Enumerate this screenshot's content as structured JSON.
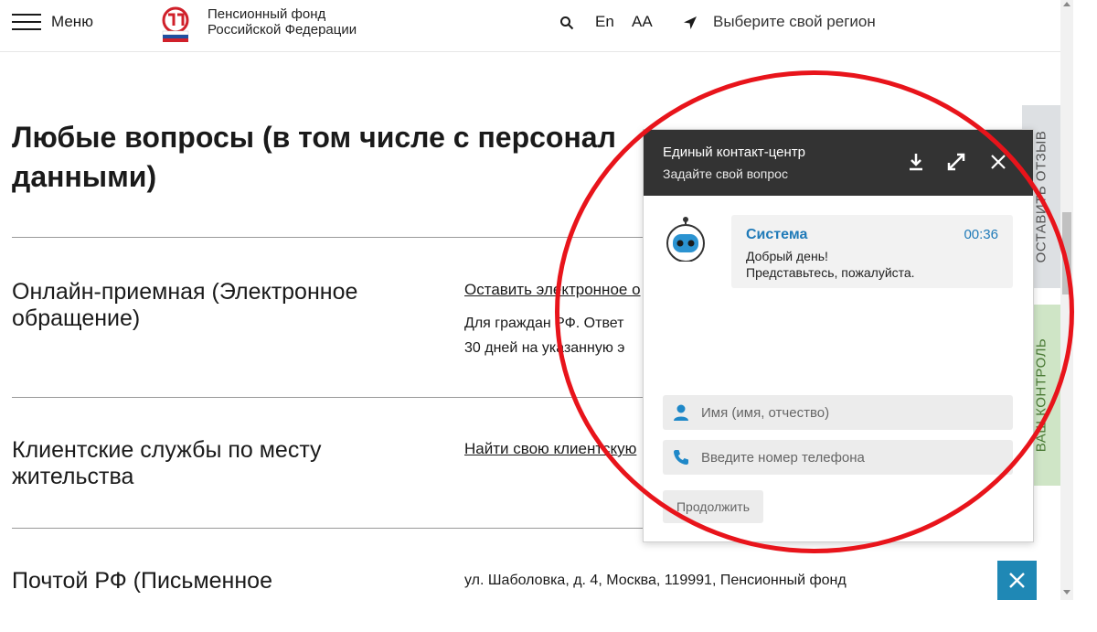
{
  "header": {
    "menu_label": "Меню",
    "logo_line1": "Пенсионный фонд",
    "logo_line2": "Российской Федерации",
    "lang": "En",
    "font_size_toggle": "AA",
    "region": "Выберите свой регион",
    "icons": [
      "hamburger-icon",
      "pfr-logo",
      "search-icon",
      "location-arrow-icon"
    ]
  },
  "page": {
    "title_line1": "Любые вопросы (в том числе с персонал",
    "title_line2": "данными)",
    "sections": [
      {
        "title": "Онлайн-приемная (Электронное обращение)",
        "link": "Оставить электронное о",
        "desc_line1": "Для граждан РФ. Ответ",
        "desc_line2": "30 дней на указанную э"
      },
      {
        "title": "Клиентские службы по месту жительства",
        "link": "Найти свою клиентскую"
      },
      {
        "title": "Почтой РФ (Письменное",
        "desc_line1": "ул. Шаболовка, д. 4, Москва, 119991, Пенсионный фонд"
      }
    ]
  },
  "side_tabs": {
    "feedback": "ОСТАВИТЬ ОТЗЫВ",
    "control": "ВАШ КОНТРОЛЬ"
  },
  "chat": {
    "title": "Единый контакт-центр",
    "subtitle": "Задайте свой вопрос",
    "message": {
      "sender": "Система",
      "time": "00:36",
      "line1": "Добрый день!",
      "line2": "Представьтесь, пожалуйста."
    },
    "name_placeholder": "Имя (имя, отчество)",
    "phone_placeholder": "Введите номер телефона",
    "continue_label": "Продолжить",
    "icons": [
      "download-icon",
      "expand-icon",
      "close-icon",
      "bot-avatar-icon",
      "user-icon",
      "phone-icon"
    ]
  },
  "colors": {
    "accent_blue": "#1f7ab8",
    "chat_header": "#333333",
    "annotation_red": "#e8141b",
    "feedback_tab": "#dde0e3",
    "control_tab": "#cfe5c6"
  }
}
